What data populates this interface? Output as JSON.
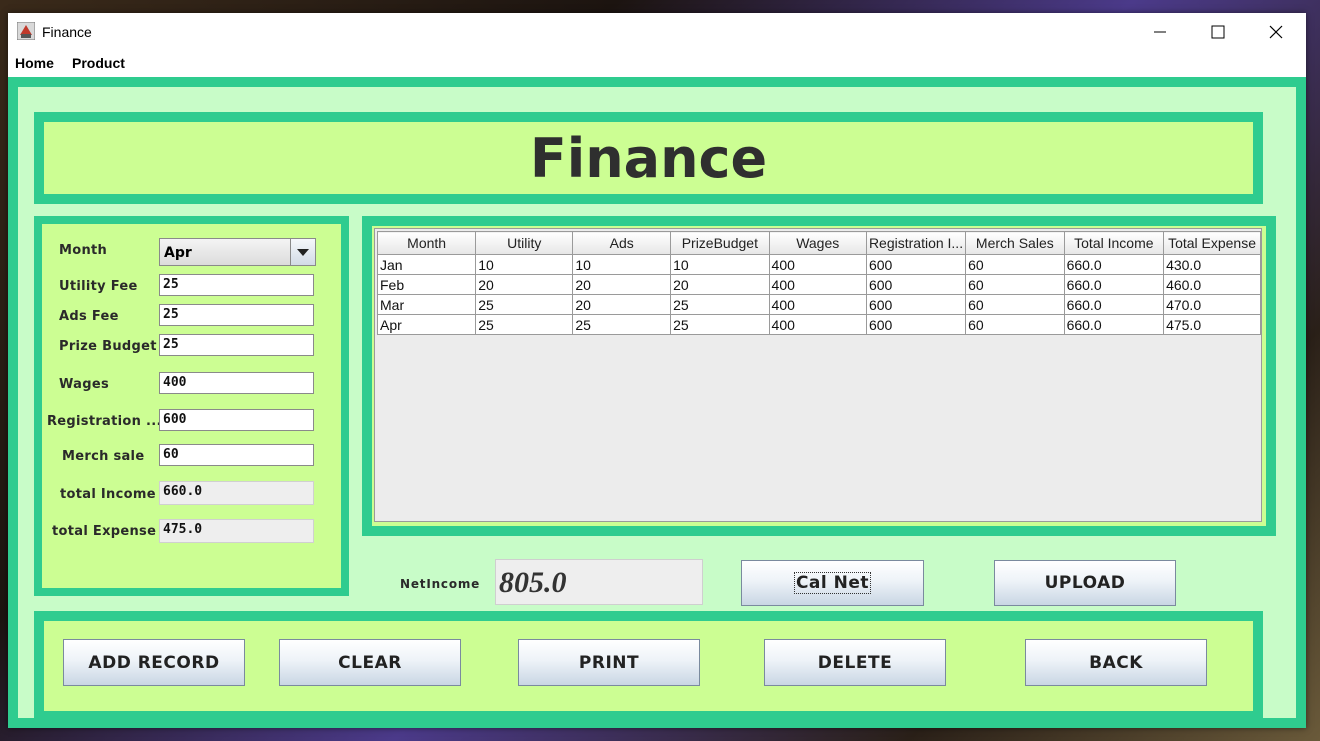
{
  "window": {
    "title": "Finance"
  },
  "menu": {
    "items": [
      "Home",
      "Product"
    ]
  },
  "header": {
    "title": "Finance"
  },
  "form": {
    "month_label": "Month",
    "month_value": "Apr",
    "utility_label": "Utility Fee",
    "utility_value": "25",
    "ads_label": "Ads Fee",
    "ads_value": "25",
    "prize_label": "Prize Budget",
    "prize_value": "25",
    "wages_label": "Wages",
    "wages_value": "400",
    "registration_label": "Registration ...",
    "registration_value": "600",
    "merch_label": "Merch sale",
    "merch_value": "60",
    "income_label": "total Income",
    "income_value": "660.0",
    "expense_label": "total Expense",
    "expense_value": "475.0"
  },
  "table": {
    "columns": [
      "Month",
      "Utility",
      "Ads",
      "PrizeBudget",
      "Wages",
      "Registration I...",
      "Merch Sales",
      "Total Income",
      "Total Expense"
    ],
    "rows": [
      [
        "Jan",
        "10",
        "10",
        "10",
        "400",
        "600",
        "60",
        "660.0",
        "430.0"
      ],
      [
        "Feb",
        "20",
        "20",
        "20",
        "400",
        "600",
        "60",
        "660.0",
        "460.0"
      ],
      [
        "Mar",
        "25",
        "20",
        "25",
        "400",
        "600",
        "60",
        "660.0",
        "470.0"
      ],
      [
        "Apr",
        "25",
        "25",
        "25",
        "400",
        "600",
        "60",
        "660.0",
        "475.0"
      ]
    ]
  },
  "net": {
    "label": "NetIncome",
    "value": "805.0"
  },
  "buttons": {
    "cal_net": "Cal Net",
    "upload": "UPLOAD",
    "add_record": "ADD RECORD",
    "clear": "CLEAR",
    "print": "PRINT",
    "delete": "DELETE",
    "back": "BACK"
  },
  "colors": {
    "frame": "#2fcc8f",
    "panel": "#ccfe93",
    "background": "#c8fcc8"
  }
}
